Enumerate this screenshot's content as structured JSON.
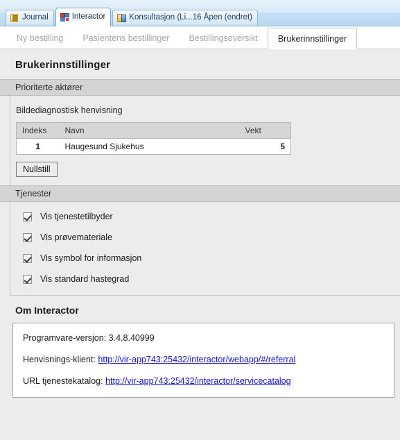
{
  "window_tabs": [
    {
      "label": "Journal",
      "icon": "journal-icon",
      "active": false
    },
    {
      "label": "Interactor",
      "icon": "interactor-icon",
      "active": true
    },
    {
      "label": "Konsultasjon (Li...16 Åpen (endret)",
      "icon": "consultation-icon",
      "active": false
    }
  ],
  "sub_tabs": [
    {
      "label": "Ny bestilling",
      "active": false
    },
    {
      "label": "Pasientens bestillinger",
      "active": false
    },
    {
      "label": "Bestillingsoversikt",
      "active": false
    },
    {
      "label": "Brukerinnstillinger",
      "active": true
    }
  ],
  "page_title": "Brukerinnstillinger",
  "sections": {
    "priority_actors": {
      "header": "Prioriterte aktører",
      "field_label": "Bildediagnostisk henvisning",
      "table": {
        "columns": [
          "Indeks",
          "Navn",
          "Vekt"
        ],
        "rows": [
          {
            "indeks": "1",
            "navn": "Haugesund Sjukehus",
            "vekt": "5"
          }
        ]
      },
      "reset_button": "Nullstill"
    },
    "services": {
      "header": "Tjenester",
      "checkboxes": [
        {
          "label": "Vis tjenestetilbyder",
          "checked": true
        },
        {
          "label": "Vis prøvemateriale",
          "checked": true
        },
        {
          "label": "Vis symbol for informasjon",
          "checked": true
        },
        {
          "label": "Vis standard hastegrad",
          "checked": true
        }
      ]
    },
    "about": {
      "header": "Om Interactor",
      "version_label": "Programvare-versjon:",
      "version_value": "3.4.8.40999",
      "referral_label": "Henvisnings-klient:",
      "referral_url": "http://vir-app743:25432/interactor/webapp/#/referral",
      "catalog_label": "URL tjenestekatalog:",
      "catalog_url": "http://vir-app743:25432/interactor/servicecatalog"
    }
  },
  "colors": {
    "window_bar_top": "#e8f2fb",
    "window_bar_bottom": "#bcd9f2",
    "page_bg": "#ececec",
    "section_header_bg": "#d4d4d4",
    "link": "#1414cf",
    "inactive_tab_text": "#a6a6a6",
    "table_header_bg": "#d6d6d6"
  }
}
